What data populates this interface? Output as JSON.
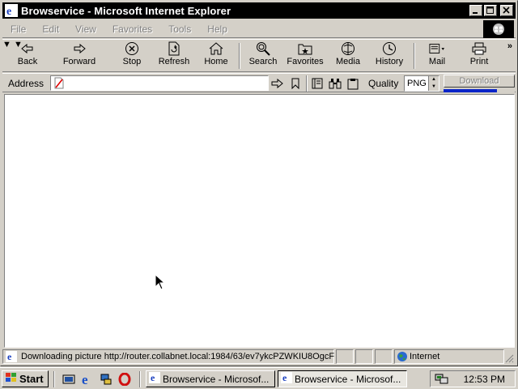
{
  "window": {
    "title": "Browservice - Microsoft Internet Explorer"
  },
  "menu": [
    "File",
    "Edit",
    "View",
    "Favorites",
    "Tools",
    "Help"
  ],
  "toolbar": {
    "back": "Back",
    "forward": "Forward",
    "stop": "Stop",
    "refresh": "Refresh",
    "home": "Home",
    "search": "Search",
    "favorites": "Favorites",
    "media": "Media",
    "history": "History",
    "mail": "Mail",
    "print": "Print"
  },
  "address": {
    "label": "Address",
    "value": ""
  },
  "quality": {
    "label": "Quality",
    "value": "PNG"
  },
  "download": {
    "label": "Download",
    "progress_fraction": 0.75
  },
  "status": {
    "text": "Downloading picture http://router.collabnet.local:1984/63/ev7ykcPZWKIU8OgcF",
    "zone": "Internet"
  },
  "taskbar": {
    "start": "Start",
    "tasks": [
      "Browservice - Microsof...",
      "Browservice - Microsof..."
    ],
    "clock": "12:53 PM"
  },
  "colors": {
    "titlebar": "#000000",
    "chrome": "#d4d0c8",
    "progress": "#0a24c8"
  }
}
